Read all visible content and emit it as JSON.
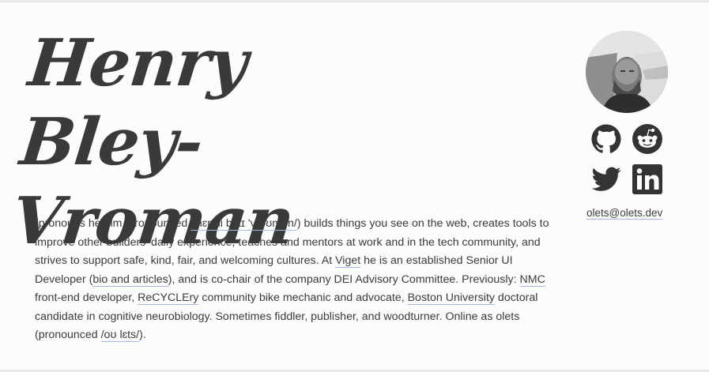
{
  "name": {
    "line1": "Henry",
    "line2": "Bley-Vroman"
  },
  "bio": {
    "t1": "(pronouns he/him, pronounced ",
    "pronunciation_link": "/'hɛn.ɹi blaɪ 'vɹəʊmən/",
    "t2": ") builds things you see on the web, creates tools to improve other builders' daily experience, teaches and mentors at work and in the tech community, and strives to support safe, kind, fair, and welcoming cultures. At ",
    "viget_link": "Viget",
    "t3": " he is an established Senior UI Developer (",
    "bio_link": "bio and articles",
    "t4": "), and is co-chair of the company DEI Advisory Committee. Previously: ",
    "nmc_link": "NMC",
    "t5": " front-end developer, ",
    "recyclery_link": "ReCYCLEry",
    "t6": " community bike mechanic and advocate, ",
    "bu_link": "Boston University",
    "t7": " doctoral candidate in cognitive neurobiology. Sometimes fiddler, publisher, and woodturner. Online as olets (pronounced ",
    "olets_pron_link": "/oʊ lɛts/",
    "t8": ")."
  },
  "contact": {
    "email": "olets@olets.dev"
  },
  "social": [
    "github-icon",
    "reddit-icon",
    "twitter-icon",
    "linkedin-icon"
  ],
  "colors": {
    "text": "#3b3b3b",
    "icon": "#333333",
    "link_underline": "#a7b5e6",
    "background": "#fcfcfc"
  }
}
